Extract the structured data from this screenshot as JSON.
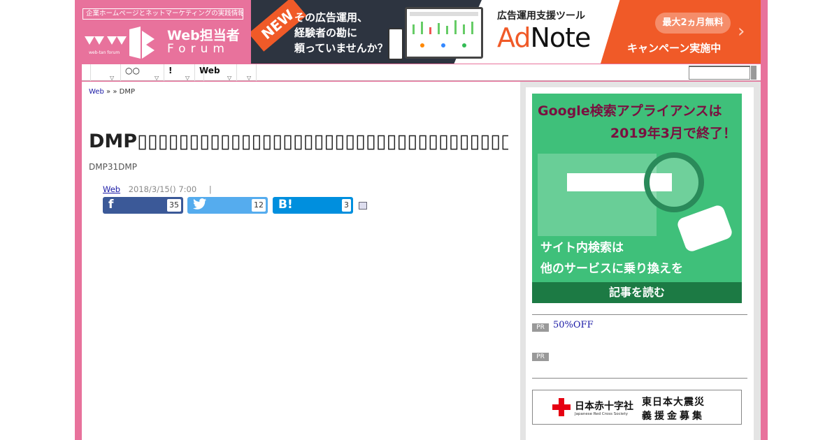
{
  "header": {
    "tagline": "企業ホームページとネットマーケティングの実践情報サイト",
    "logo_small": "web-tan forum",
    "logo_word1": "Web担当者",
    "logo_word2": "Forum"
  },
  "banner": {
    "badge": "NEW",
    "copy_line1": "その広告運用、",
    "copy_line2": "経験者の勘に",
    "copy_line3": "頼っていませんか？",
    "service": "広告運用支援ツール",
    "brand_a": "Ad",
    "brand_b": "Note",
    "pill": "最大2ヵ月無料",
    "cta": "キャンペーン実施中",
    "arrow": "›"
  },
  "nav": {
    "items": [
      {
        "label": ""
      },
      {
        "label": "○○"
      },
      {
        "label": "!"
      },
      {
        "label": ""
      },
      {
        "label": "Web"
      },
      {
        "label": ""
      }
    ],
    "arrow_glyph": "▽"
  },
  "breadcrumb": {
    "home": "Web",
    "sep1": "»",
    "sep2": "»",
    "current": "DMP"
  },
  "article": {
    "title": "DMP▯▯▯▯▯▯▯▯▯▯▯▯▯▯▯▯▯▯▯▯▯▯▯▯▯▯▯▯▯▯▯▯▯▯▯▯▯▯▯▯▯▯",
    "subtitle": "DMP31DMP",
    "category": "Web",
    "date": "2018/3/15() 7:00",
    "divider": "|"
  },
  "share": {
    "facebook": {
      "icon": "f",
      "count": "35",
      "color": "#3b5998"
    },
    "twitter": {
      "icon": "🐦",
      "count": "12",
      "color": "#55acee"
    },
    "hatena": {
      "icon": "B!",
      "count": "3",
      "color": "#008fde"
    }
  },
  "sidebar": {
    "ad_google": {
      "headline1": "Google検索アプライアンスは",
      "headline2": "2019年3月で終了！",
      "text1": "サイト内検索は",
      "text2": "他のサービスに乗り換えを",
      "footer": "記事を読む"
    },
    "pr1": {
      "badge": "PR",
      "text": "50%OFF"
    },
    "pr2": {
      "badge": "PR",
      "text": ""
    },
    "redcross": {
      "name": "日本赤十字社",
      "sub": "Japanese Red Cross Society",
      "line1": "東日本大震災",
      "line2": "義援金募集"
    }
  },
  "colors": {
    "brand_pink": "#e8729c",
    "link_blue": "#1a1aa6",
    "banner_orange": "#f05a28",
    "ad_green": "#3fc07a"
  }
}
